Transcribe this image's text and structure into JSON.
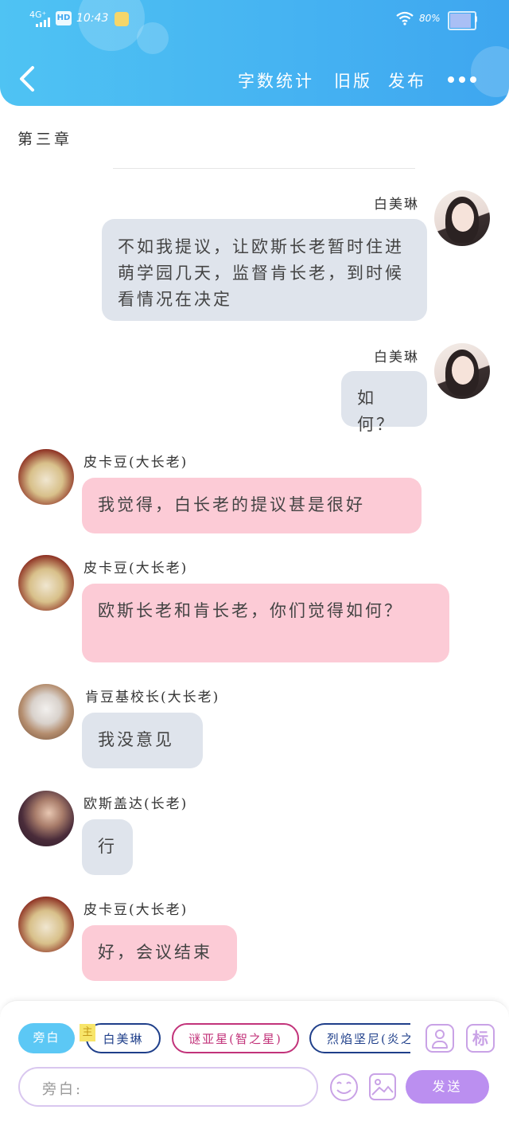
{
  "status_bar": {
    "network": "4G⁺",
    "hd": "HD",
    "time": "10:43",
    "battery": "80%"
  },
  "header": {
    "back_icon": "chevron-left-icon",
    "word_count": "字数统计",
    "old_version": "旧版",
    "publish": "发布",
    "more_icon": "more-dots-icon"
  },
  "chapter_title": "第三章",
  "messages": [
    {
      "name": "白美琳",
      "text": "不如我提议，让欧斯长老暂时住进萌学园几天，监督肯长老，到时候看情况在决定"
    },
    {
      "name": "白美琳",
      "text": "如何？"
    },
    {
      "name": "皮卡豆(大长老)",
      "text": "我觉得，白长老的提议甚是很好"
    },
    {
      "name": "皮卡豆(大长老)",
      "text": "欧斯长老和肯长老，你们觉得如何？"
    },
    {
      "name": "肯豆基校长(大长老)",
      "text": "我没意见"
    },
    {
      "name": "欧斯盖达(长老)",
      "text": "行"
    },
    {
      "name": "皮卡豆(大长老)",
      "text": "好，会议结束"
    }
  ],
  "composer": {
    "role_chips": [
      "旁白",
      "白美琳",
      "谜亚星(智之星)",
      "烈焰坚尼(炎之"
    ],
    "main_badge": "主",
    "input_placeholder": "旁白:",
    "send_label": "发送",
    "mark_label": "标"
  },
  "colors": {
    "header": "#45b2f2",
    "gray_bubble": "#dfe4ec",
    "pink_bubble": "#fccbd6",
    "send": "#bb8ff0"
  }
}
